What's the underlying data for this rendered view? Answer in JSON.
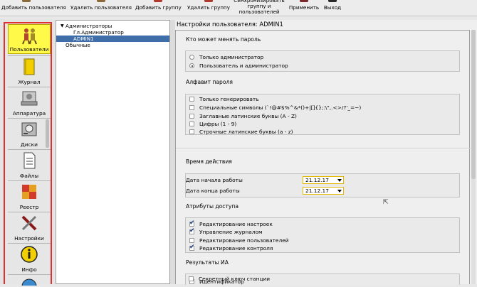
{
  "toolbar": {
    "buttons": [
      {
        "label": "Добавить пользователя",
        "icon": "add-user-icon"
      },
      {
        "label": "Удалить пользователя",
        "icon": "delete-user-icon"
      },
      {
        "label": "Добавить группу",
        "icon": "add-group-icon"
      },
      {
        "label": "Удалить группу",
        "icon": "delete-group-icon"
      },
      {
        "label": "Синхронизировать группу и пользователей",
        "icon": "sync-icon"
      },
      {
        "label": "Применить",
        "icon": "apply-icon"
      },
      {
        "label": "Выход",
        "icon": "exit-icon"
      }
    ]
  },
  "sidebar": {
    "items": [
      {
        "label": "Пользователи",
        "icon": "users-icon",
        "active": true
      },
      {
        "label": "Журнал",
        "icon": "journal-icon"
      },
      {
        "label": "Аппаратура",
        "icon": "hardware-icon"
      },
      {
        "label": "Диски",
        "icon": "disks-icon"
      },
      {
        "label": "Файлы",
        "icon": "files-icon"
      },
      {
        "label": "Реестр",
        "icon": "registry-icon"
      },
      {
        "label": "Настройки",
        "icon": "settings-icon"
      },
      {
        "label": "Инфо",
        "icon": "info-icon"
      }
    ]
  },
  "tree": {
    "nodes": [
      {
        "label": "Администраторы",
        "expanded": true
      },
      {
        "label": "Гл.Администратор"
      },
      {
        "label": "ADMIN1",
        "selected": true
      },
      {
        "label": "Обычные"
      }
    ]
  },
  "settings": {
    "title": "Настройки пользователя: ADMIN1",
    "who_changes_password": {
      "title": "Кто может менять пароль",
      "options": [
        {
          "label": "Только администратор",
          "selected": false
        },
        {
          "label": "Пользователь и администратор",
          "selected": true
        }
      ]
    },
    "password_alphabet": {
      "title": "Алфавит пароля",
      "options": [
        {
          "label": "Только генерировать",
          "checked": false
        },
        {
          "label": "Специальные символы (`!@#$%^&*()+|[]{};:\\\",.<>/?'_=~)",
          "checked": false
        },
        {
          "label": "Заглавные латинские буквы (A - Z)",
          "checked": false
        },
        {
          "label": "Цифры (1 - 9)",
          "checked": false
        },
        {
          "label": "Строчные латинские буквы (a - z)",
          "checked": false
        }
      ]
    },
    "validity": {
      "title": "Время действия",
      "start_label": "Дата начала работы",
      "start_value": "21.12.17",
      "end_label": "Дата конца работы",
      "end_value": "21.12.17"
    },
    "access_attributes": {
      "title": "Атрибуты доступа",
      "options": [
        {
          "label": "Редактирование настроек",
          "checked": true
        },
        {
          "label": "Управление журналом",
          "checked": true
        },
        {
          "label": "Редактирование пользователей",
          "checked": false
        },
        {
          "label": "Редактирование контроля",
          "checked": true
        }
      ]
    },
    "ia_results": {
      "title": "Результаты ИА",
      "options": [
        {
          "label": "Идентификатор",
          "checked": false
        },
        {
          "label": "Секретный ключ станции",
          "checked": false
        }
      ]
    }
  },
  "colors": {
    "selection": "#3f6ea8",
    "active_nav": "#fff94a",
    "sidebar_border": "#e03030",
    "date_border": "#e0b800"
  }
}
